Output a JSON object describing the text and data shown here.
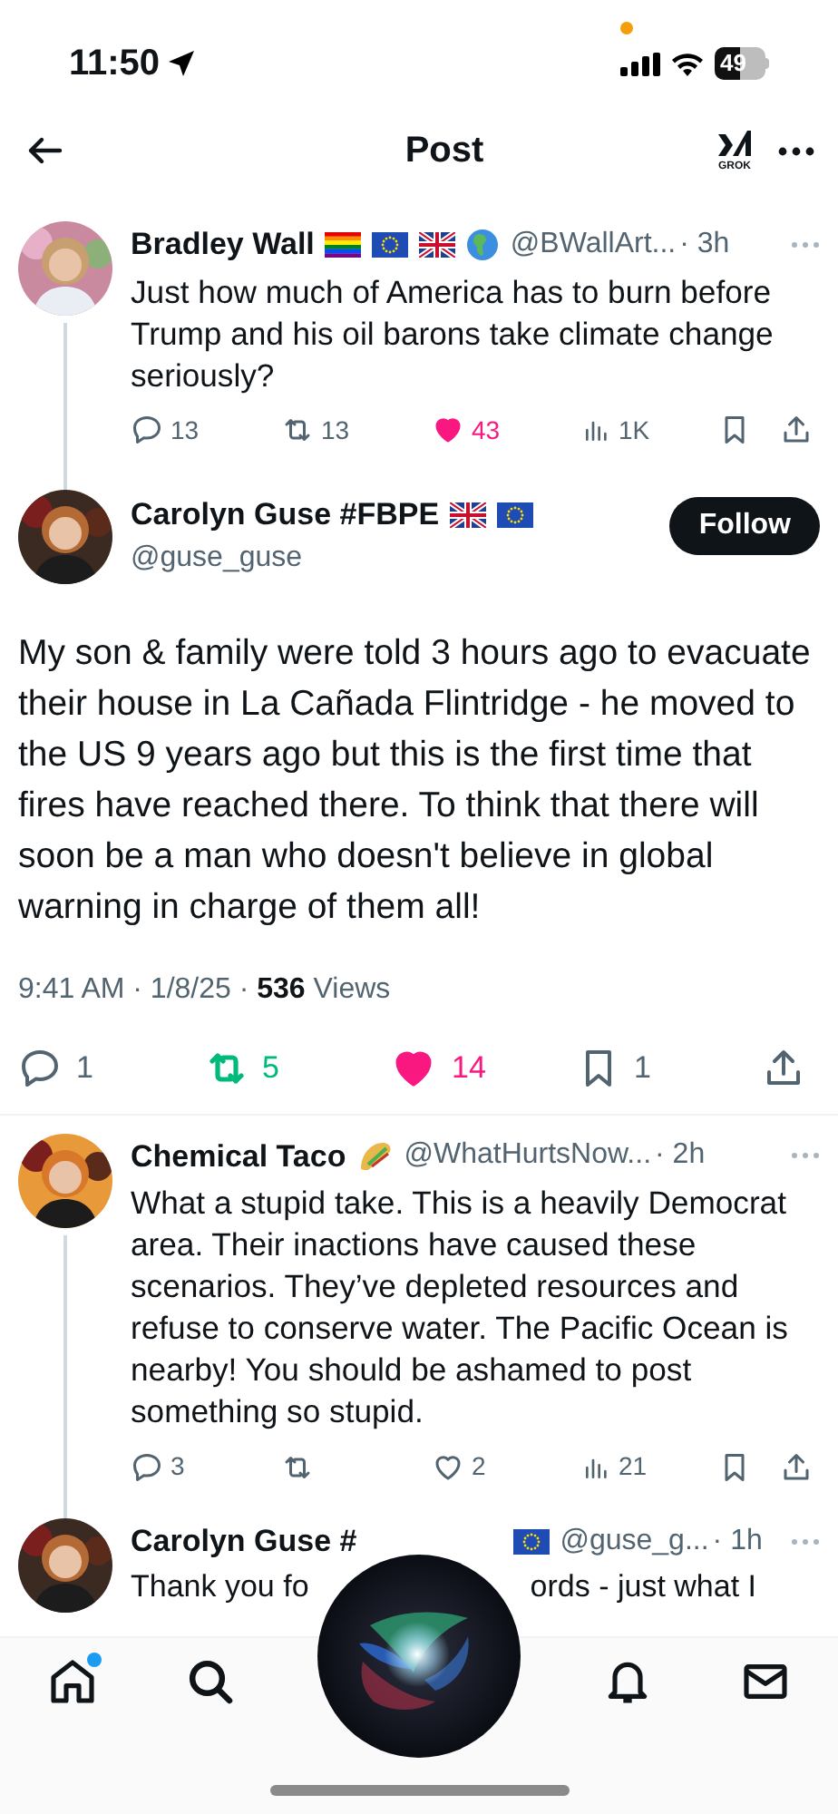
{
  "status_bar": {
    "time": "11:50",
    "battery": "49"
  },
  "header": {
    "title": "Post",
    "grok_label": "GROK"
  },
  "parent_post": {
    "name": "Bradley Wall",
    "handle": "@BWallArt...",
    "time": "· 3h",
    "text": "Just how much of America has to burn before Trump and his oil barons take climate change seriously?",
    "actions": {
      "replies": "13",
      "reposts": "13",
      "likes": "43",
      "views": "1K",
      "liked": true,
      "reposted": false
    }
  },
  "main_post": {
    "name": "Carolyn Guse #FBPE",
    "handle": "@guse_guse",
    "follow_label": "Follow",
    "text": "My son & family were told 3 hours ago to evacuate their house in La Cañada Flintridge - he moved to the US 9 years ago but this is the first time that fires have reached there. To think that there will soon be a man who doesn't believe in global warning in charge of them all!",
    "meta": "9:41 AM · 1/8/25 · **536** Views",
    "actions": {
      "replies": "1",
      "reposts": "5",
      "likes": "14",
      "bookmarks": "1",
      "liked": true,
      "reposted": true
    }
  },
  "reply": {
    "name": "Chemical Taco",
    "handle": "@WhatHurtsNow...",
    "time": "· 2h",
    "text": "What a stupid take. This is a heavily Democrat area. Their inactions have caused these scenarios. They’ve depleted resources and refuse to conserve water. The Pacific Ocean is nearby! You should be ashamed to post something so stupid.",
    "actions": {
      "replies": "3",
      "likes": "2",
      "views": "21",
      "liked": false,
      "reposted": false
    }
  },
  "last_reply": {
    "name": "Carolyn Guse #",
    "handle": "@guse_g...",
    "time": "· 1h",
    "text_left": "Thank you fo",
    "text_right": "ords - just what I"
  },
  "tab_bar": [
    {
      "kind": "home",
      "unread": true
    },
    {
      "kind": "search",
      "unread": false
    },
    {
      "kind": "bell",
      "unread": false
    },
    {
      "kind": "mail",
      "unread": false
    }
  ]
}
